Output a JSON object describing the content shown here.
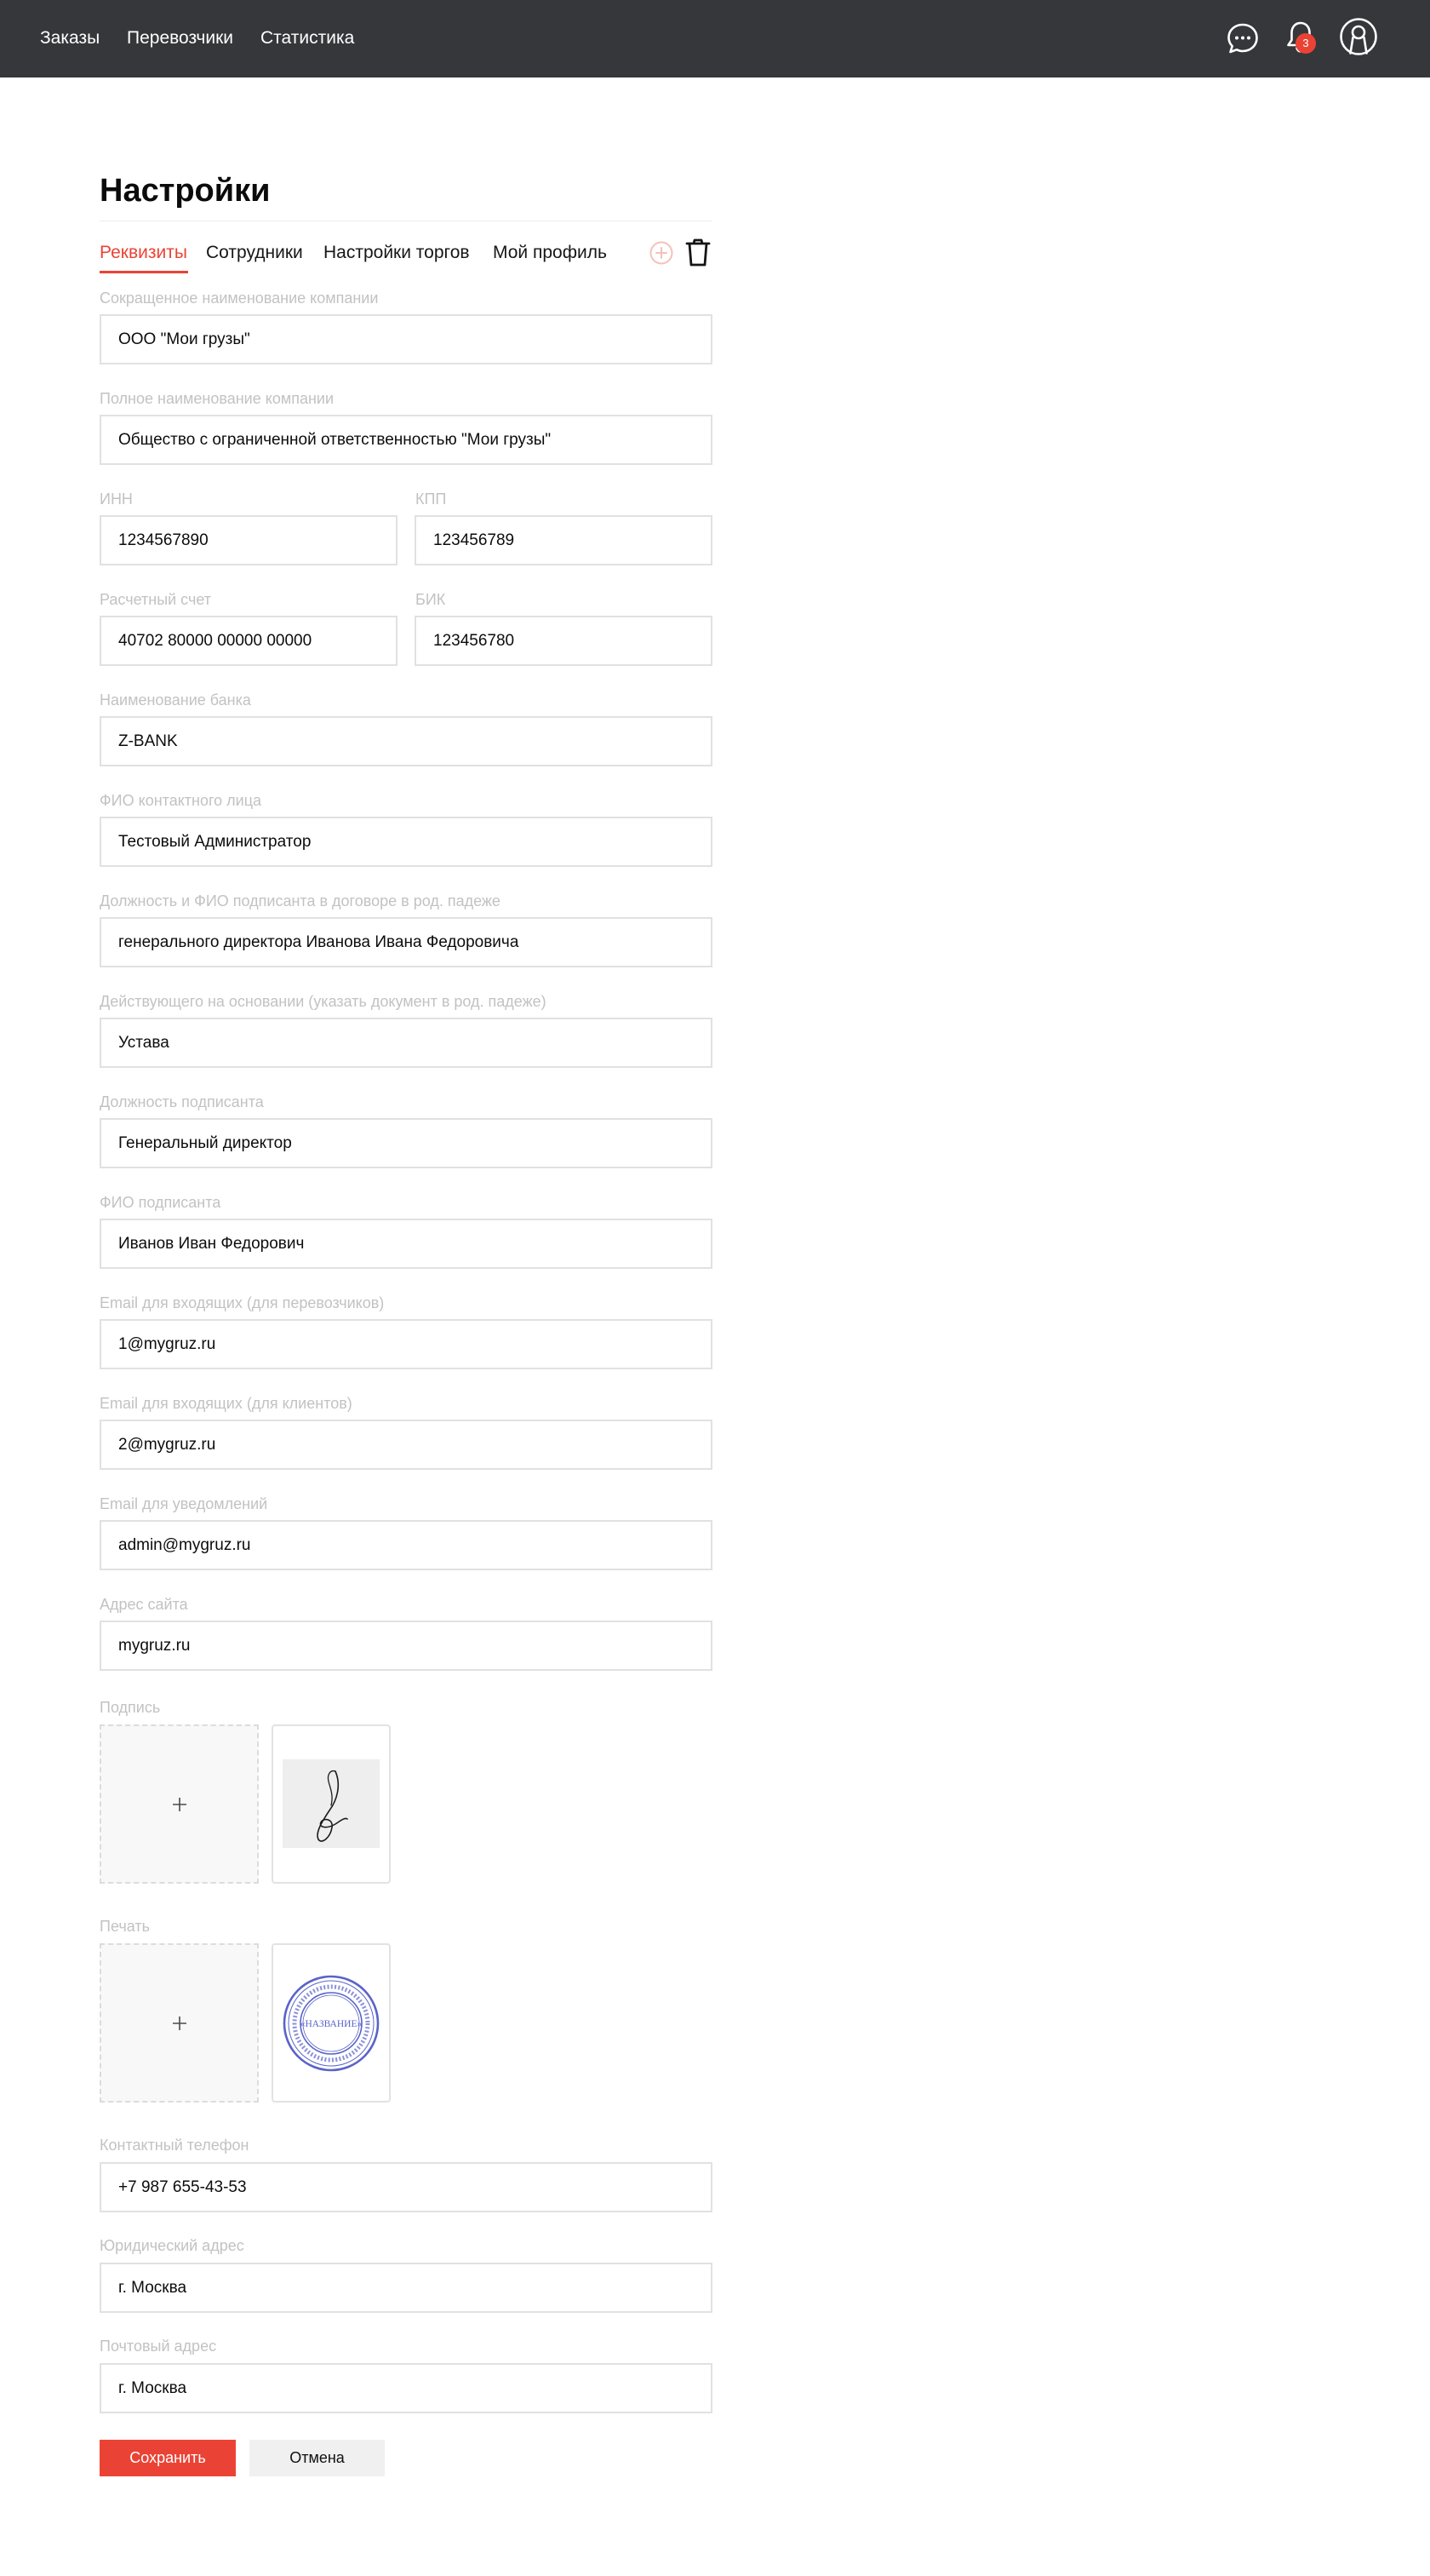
{
  "nav": {
    "items": [
      "Заказы",
      "Перевозчики",
      "Статистика"
    ],
    "notifications_count": "3",
    "icons": [
      "chat-icon",
      "bell-icon",
      "user-icon"
    ]
  },
  "page": {
    "title": "Настройки",
    "tabs": [
      "Реквизиты",
      "Сотрудники",
      "Настройки торгов",
      "Мой профиль"
    ],
    "active_tab": "Реквизиты",
    "tab_icons": [
      "add-circle-icon",
      "trash-icon"
    ]
  },
  "fields": {
    "short_name": {
      "label": "Сокращенное наименование компании",
      "value": "ООО \"Мои грузы\""
    },
    "full_name": {
      "label": "Полное наименование компании",
      "value": "Общество с ограниченной ответственностью \"Мои грузы\""
    },
    "inn": {
      "label": "ИНН",
      "value": "1234567890"
    },
    "kpp": {
      "label": "КПП",
      "value": "123456789"
    },
    "account": {
      "label": "Расчетный счет",
      "value": "40702 80000 00000 00000"
    },
    "bik": {
      "label": "БИК",
      "value": "123456780"
    },
    "bank": {
      "label": "Наименование банка",
      "value": "Z-BANK"
    },
    "contact": {
      "label": "ФИО контактного лица",
      "value": "Тестовый Администратор"
    },
    "signer_genitive": {
      "label": "Должность и ФИО подписанта в договоре в род. падеже",
      "value": "генерального директора Иванова Ивана Федоровича"
    },
    "basis": {
      "label": "Действующего на основании (указать документ в род. падеже)",
      "value": "Устава"
    },
    "signer_position": {
      "label": "Должность подписанта",
      "value": "Генеральный директор"
    },
    "signer_name": {
      "label": "ФИО подписанта",
      "value": "Иванов Иван Федорович"
    },
    "email_carriers": {
      "label": "Email для входящих (для перевозчиков)",
      "value": "1@mygruz.ru"
    },
    "email_clients": {
      "label": "Email для входящих (для клиентов)",
      "value": "2@mygruz.ru"
    },
    "email_notify": {
      "label": "Email для уведомлений",
      "value": "admin@mygruz.ru"
    },
    "website": {
      "label": "Адрес сайта",
      "value": "mygruz.ru"
    },
    "phone": {
      "label": "Контактный телефон",
      "value": "+7 987 655-43-53"
    },
    "legal_address": {
      "label": "Юридический адрес",
      "value": "г. Москва"
    },
    "postal_address": {
      "label": "Почтовый адрес",
      "value": "г. Москва"
    }
  },
  "uploads": {
    "signature": {
      "label": "Подпись",
      "add_icon": "plus-icon"
    },
    "stamp": {
      "label": "Печать",
      "add_icon": "plus-icon",
      "stamp_text": "«НАЗВАНИЕ»"
    }
  },
  "buttons": {
    "save": "Сохранить",
    "cancel": "Отмена"
  },
  "colors": {
    "topbar": "#36373b",
    "accent": "#ea4335",
    "label": "#c2c2c2",
    "border": "#e1e1e1",
    "stamp": "#5a63c9"
  }
}
